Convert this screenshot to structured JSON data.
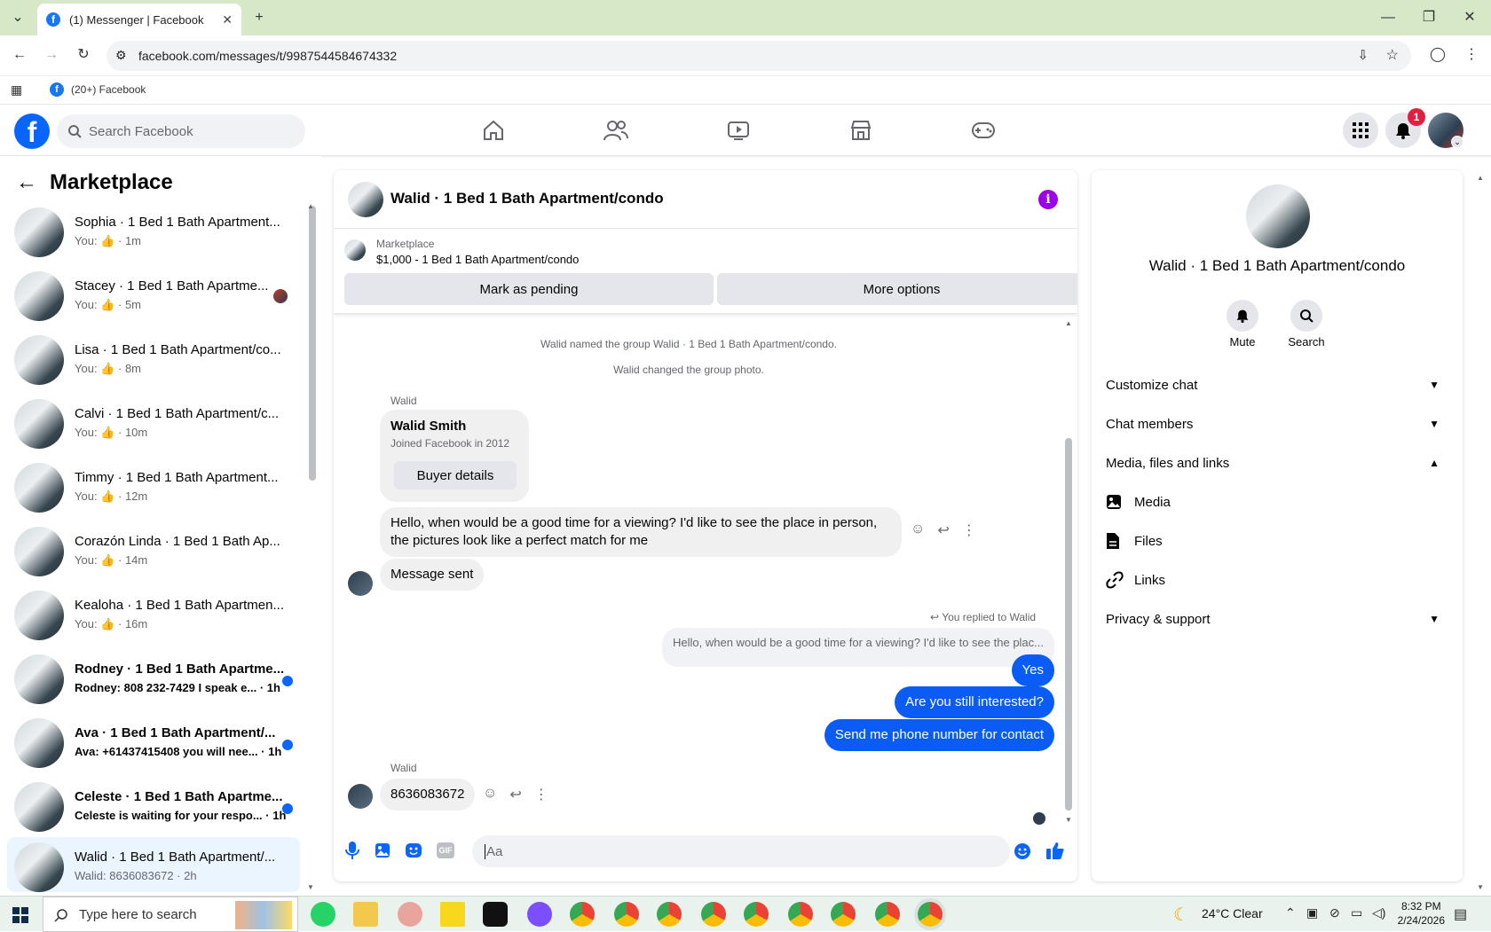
{
  "browser": {
    "tab_title": "(1) Messenger | Facebook",
    "url": "facebook.com/messages/t/9987544584674332",
    "bookmark": "(20+) Facebook"
  },
  "fb": {
    "search_placeholder": "Search Facebook",
    "notification_count": "1"
  },
  "left": {
    "title": "Marketplace",
    "conversations": [
      {
        "name": "Sophia · 1 Bed 1 Bath Apartment...",
        "sub_prefix": "You:",
        "time": "· 1m"
      },
      {
        "name": "Stacey · 1 Bed 1 Bath Apartme...",
        "sub_prefix": "You:",
        "time": "· 5m"
      },
      {
        "name": "Lisa · 1 Bed 1 Bath Apartment/co...",
        "sub_prefix": "You:",
        "time": "· 8m"
      },
      {
        "name": "Calvi · 1 Bed 1 Bath Apartment/c...",
        "sub_prefix": "You:",
        "time": "· 10m"
      },
      {
        "name": "Timmy · 1 Bed 1 Bath Apartment...",
        "sub_prefix": "You:",
        "time": "· 12m"
      },
      {
        "name": "Corazón Linda · 1 Bed 1 Bath Ap...",
        "sub_prefix": "You:",
        "time": "· 14m"
      },
      {
        "name": "Kealoha · 1 Bed 1 Bath Apartmen...",
        "sub_prefix": "You:",
        "time": "· 16m"
      },
      {
        "name": "Rodney · 1 Bed 1 Bath Apartme...",
        "sub": "Rodney: 808 232-7429 I speak e... · 1h"
      },
      {
        "name": "Ava · 1 Bed 1 Bath Apartment/...",
        "sub": "Ava: +61437415408 you will nee... · 1h"
      },
      {
        "name": "Celeste · 1 Bed 1 Bath Apartme...",
        "sub": "Celeste is waiting for your respo... · 1h"
      },
      {
        "name": "Walid · 1 Bed 1 Bath Apartment/...",
        "sub": "Walid: 8636083672 · 2h"
      }
    ]
  },
  "chat": {
    "title": "Walid · 1 Bed 1 Bath Apartment/condo",
    "listing_source": "Marketplace",
    "listing_title": "$1,000 - 1 Bed 1 Bath Apartment/condo",
    "mark_pending": "Mark as pending",
    "more_options": "More options",
    "sys1": "Walid named the group Walid · 1 Bed 1 Bath Apartment/condo.",
    "sys2": "Walid changed the group photo.",
    "sender": "Walid",
    "card_name": "Walid Smith",
    "card_joined": "Joined Facebook in 2012",
    "buyer_details": "Buyer details",
    "msg_viewing": "Hello, when would be a good time for a viewing? I'd like to see the place in person, the pictures look like a perfect match for me",
    "msg_sent": "Message sent",
    "replied_to": "You replied to Walid",
    "quoted": "Hello, when would be a good time for a viewing? I'd like to see the plac...",
    "out1": "Yes",
    "out2": "Are you still interested?",
    "out3": "Send me phone number for contact",
    "sender2": "Walid",
    "msg_phone": "8636083672",
    "composer_placeholder": "Aa"
  },
  "right": {
    "title": "Walid · 1 Bed 1 Bath Apartment/condo",
    "mute": "Mute",
    "search": "Search",
    "customize": "Customize chat",
    "members": "Chat members",
    "media_section": "Media, files and links",
    "media": "Media",
    "files": "Files",
    "links": "Links",
    "privacy": "Privacy & support"
  },
  "taskbar": {
    "search_placeholder": "Type here to search",
    "weather": "24°C  Clear",
    "time": "8:32 PM",
    "date": "2/24/2026"
  },
  "colors": {
    "brand": "#0866ff",
    "outgoing_bubble": "#0a5cf5",
    "info": "#9b00e8"
  }
}
